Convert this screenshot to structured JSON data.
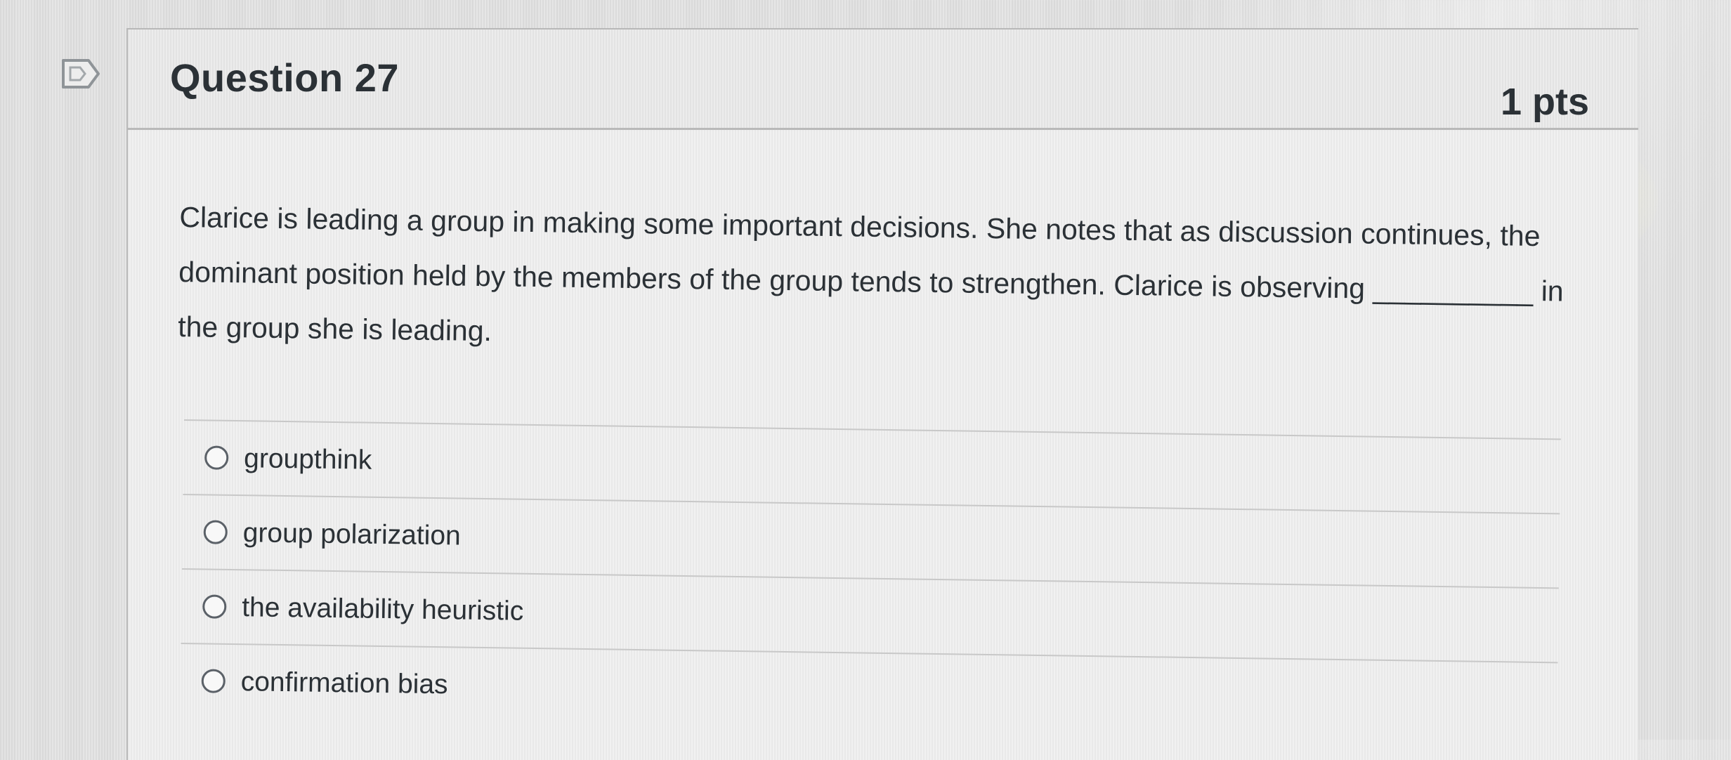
{
  "question": {
    "title": "Question 27",
    "points": "1 pts",
    "text": "Clarice is leading a group in making some important decisions. She notes that as discussion continues, the dominant position held by the members of the group tends to strengthen. Clarice is observing __________ in the group she is leading."
  },
  "answers": [
    {
      "label": "groupthink",
      "icon": "radio-icon"
    },
    {
      "label": "group polarization",
      "icon": "radio-icon"
    },
    {
      "label": "the availability heuristic",
      "icon": "radio-icon"
    },
    {
      "label": "confirmation bias",
      "icon": "radio-icon"
    }
  ],
  "icons": {
    "flag": "flag-icon"
  },
  "colors": {
    "text": "#2b3136",
    "border": "#b8b8b8",
    "radio": "#5b6168"
  }
}
